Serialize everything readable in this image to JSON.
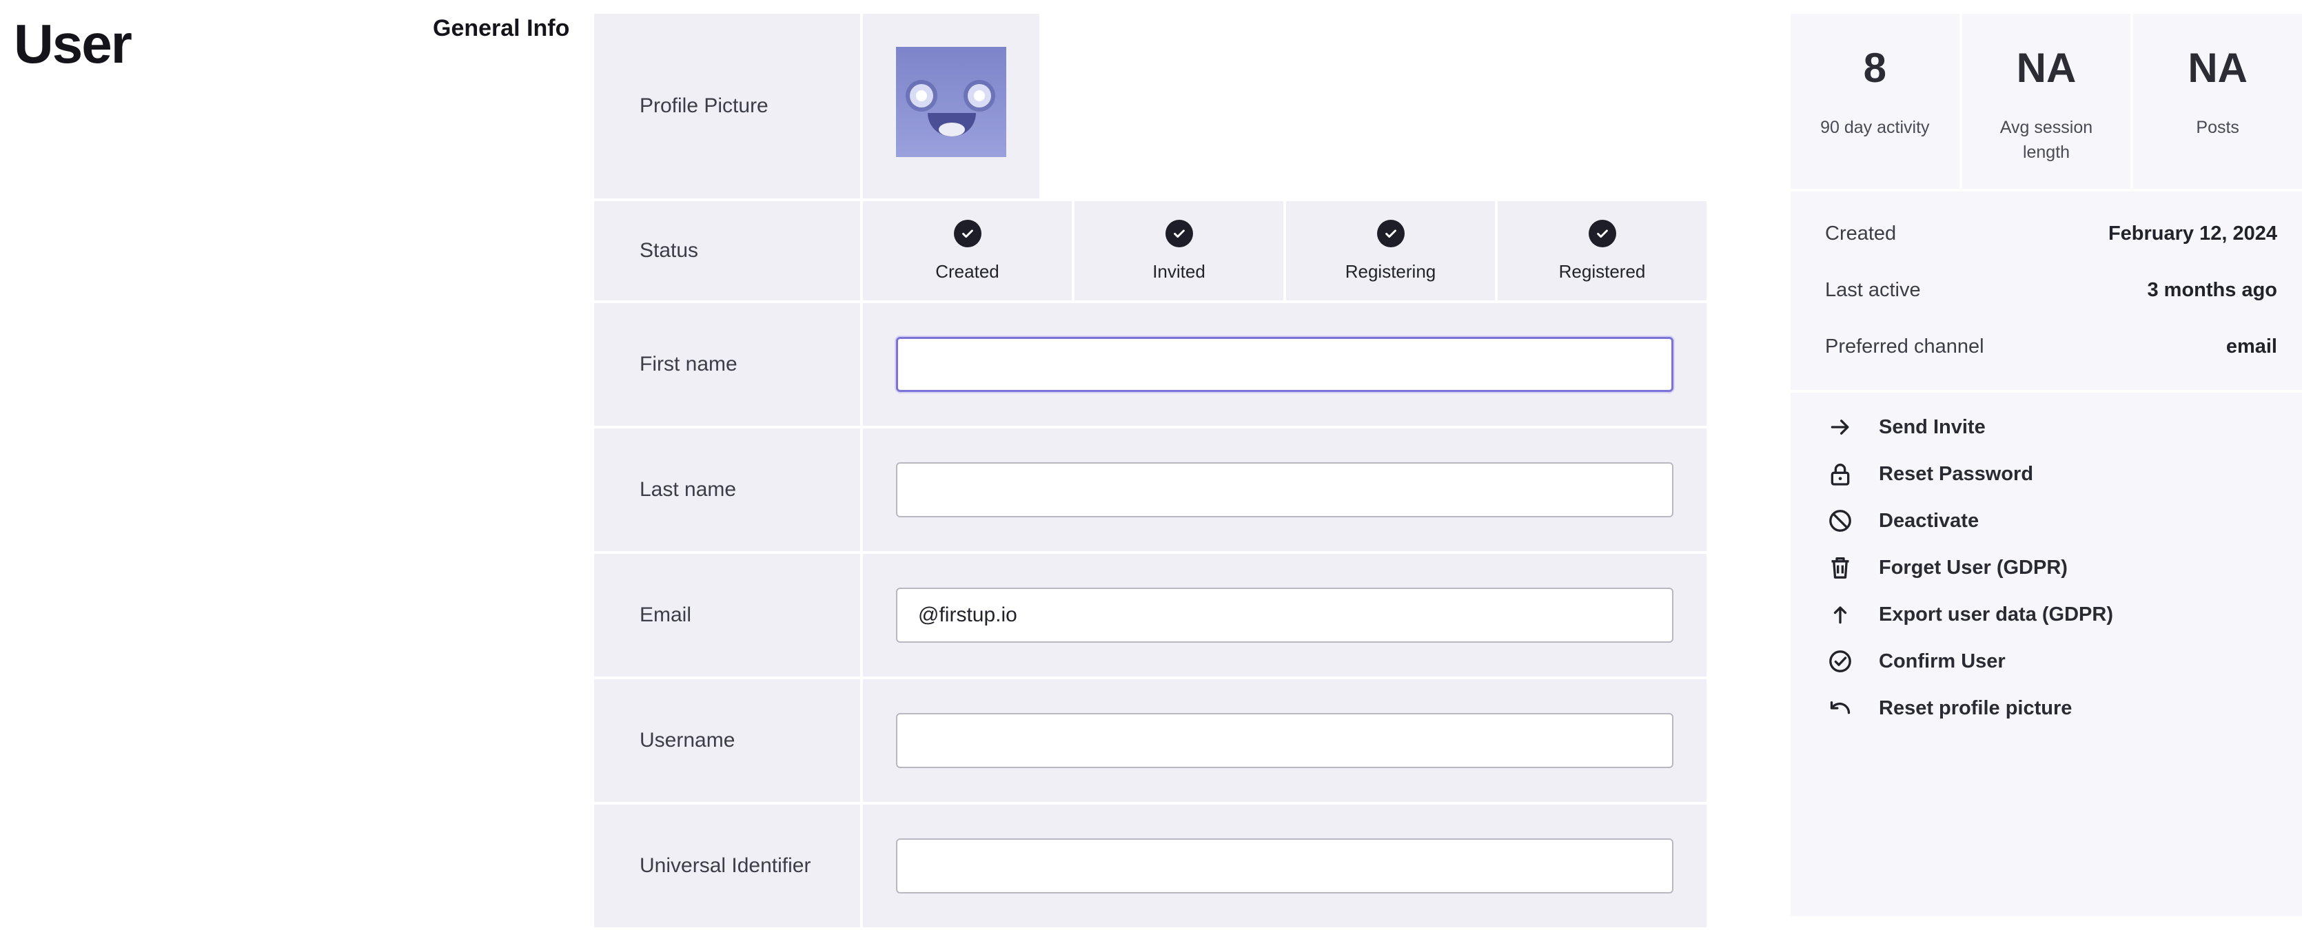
{
  "page": {
    "title": "User",
    "section_title": "General Info"
  },
  "form": {
    "profile_picture_label": "Profile Picture",
    "status_label": "Status",
    "status_steps": [
      "Created",
      "Invited",
      "Registering",
      "Registered"
    ],
    "fields": {
      "first_name": {
        "label": "First name",
        "value": ""
      },
      "last_name": {
        "label": "Last name",
        "value": ""
      },
      "email": {
        "label": "Email",
        "value": "@firstup.io"
      },
      "username": {
        "label": "Username",
        "value": ""
      },
      "universal_identifier": {
        "label": "Universal Identifier",
        "value": ""
      }
    }
  },
  "stats": [
    {
      "value": "8",
      "label": "90 day activity"
    },
    {
      "value": "NA",
      "label": "Avg session length"
    },
    {
      "value": "NA",
      "label": "Posts"
    }
  ],
  "meta": [
    {
      "key": "Created",
      "value": "February 12, 2024"
    },
    {
      "key": "Last active",
      "value": "3 months ago"
    },
    {
      "key": "Preferred channel",
      "value": "email"
    }
  ],
  "actions": [
    {
      "label": "Send Invite",
      "icon": "arrow-right-icon"
    },
    {
      "label": "Reset Password",
      "icon": "lock-icon"
    },
    {
      "label": "Deactivate",
      "icon": "ban-icon"
    },
    {
      "label": "Forget User (GDPR)",
      "icon": "trash-icon"
    },
    {
      "label": "Export user data (GDPR)",
      "icon": "arrow-up-icon"
    },
    {
      "label": "Confirm User",
      "icon": "check-circle-icon"
    },
    {
      "label": "Reset profile picture",
      "icon": "undo-icon"
    }
  ],
  "colors": {
    "panel": "#efeff5",
    "focus": "#7b73d6",
    "check": "#1e1e28"
  }
}
